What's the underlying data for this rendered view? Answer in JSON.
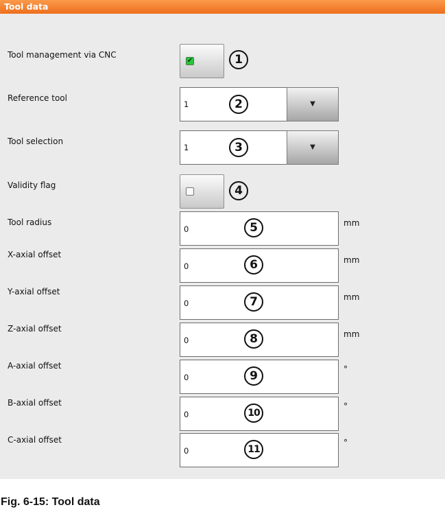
{
  "panel": {
    "title": "Tool data"
  },
  "rows": {
    "tool_management": {
      "label": "Tool management via CNC",
      "checked": true,
      "callout": "1"
    },
    "reference_tool": {
      "label": "Reference tool",
      "value": "1",
      "callout": "2"
    },
    "tool_selection": {
      "label": "Tool selection",
      "value": "1",
      "callout": "3"
    },
    "validity_flag": {
      "label": "Validity flag",
      "checked": false,
      "callout": "4"
    },
    "tool_radius": {
      "label": "Tool radius",
      "value": "0",
      "unit": "mm",
      "callout": "5"
    },
    "x_offset": {
      "label": "X-axial offset",
      "value": "0",
      "unit": "mm",
      "callout": "6"
    },
    "y_offset": {
      "label": "Y-axial offset",
      "value": "0",
      "unit": "mm",
      "callout": "7"
    },
    "z_offset": {
      "label": "Z-axial offset",
      "value": "0",
      "unit": "mm",
      "callout": "8"
    },
    "a_offset": {
      "label": "A-axial offset",
      "value": "0",
      "unit": "°",
      "callout": "9"
    },
    "b_offset": {
      "label": "B-axial offset",
      "value": "0",
      "unit": "°",
      "callout": "10"
    },
    "c_offset": {
      "label": "C-axial offset",
      "value": "0",
      "unit": "°",
      "callout": "11"
    }
  },
  "icons": {
    "checkbox_checked": "check-icon",
    "dropdown_arrow": "caret-down-icon"
  },
  "colors": {
    "header": "#f07a24",
    "background": "#ebebeb",
    "checkbox_on": "#27c63a"
  },
  "caption": "Fig. 6-15: Tool data"
}
